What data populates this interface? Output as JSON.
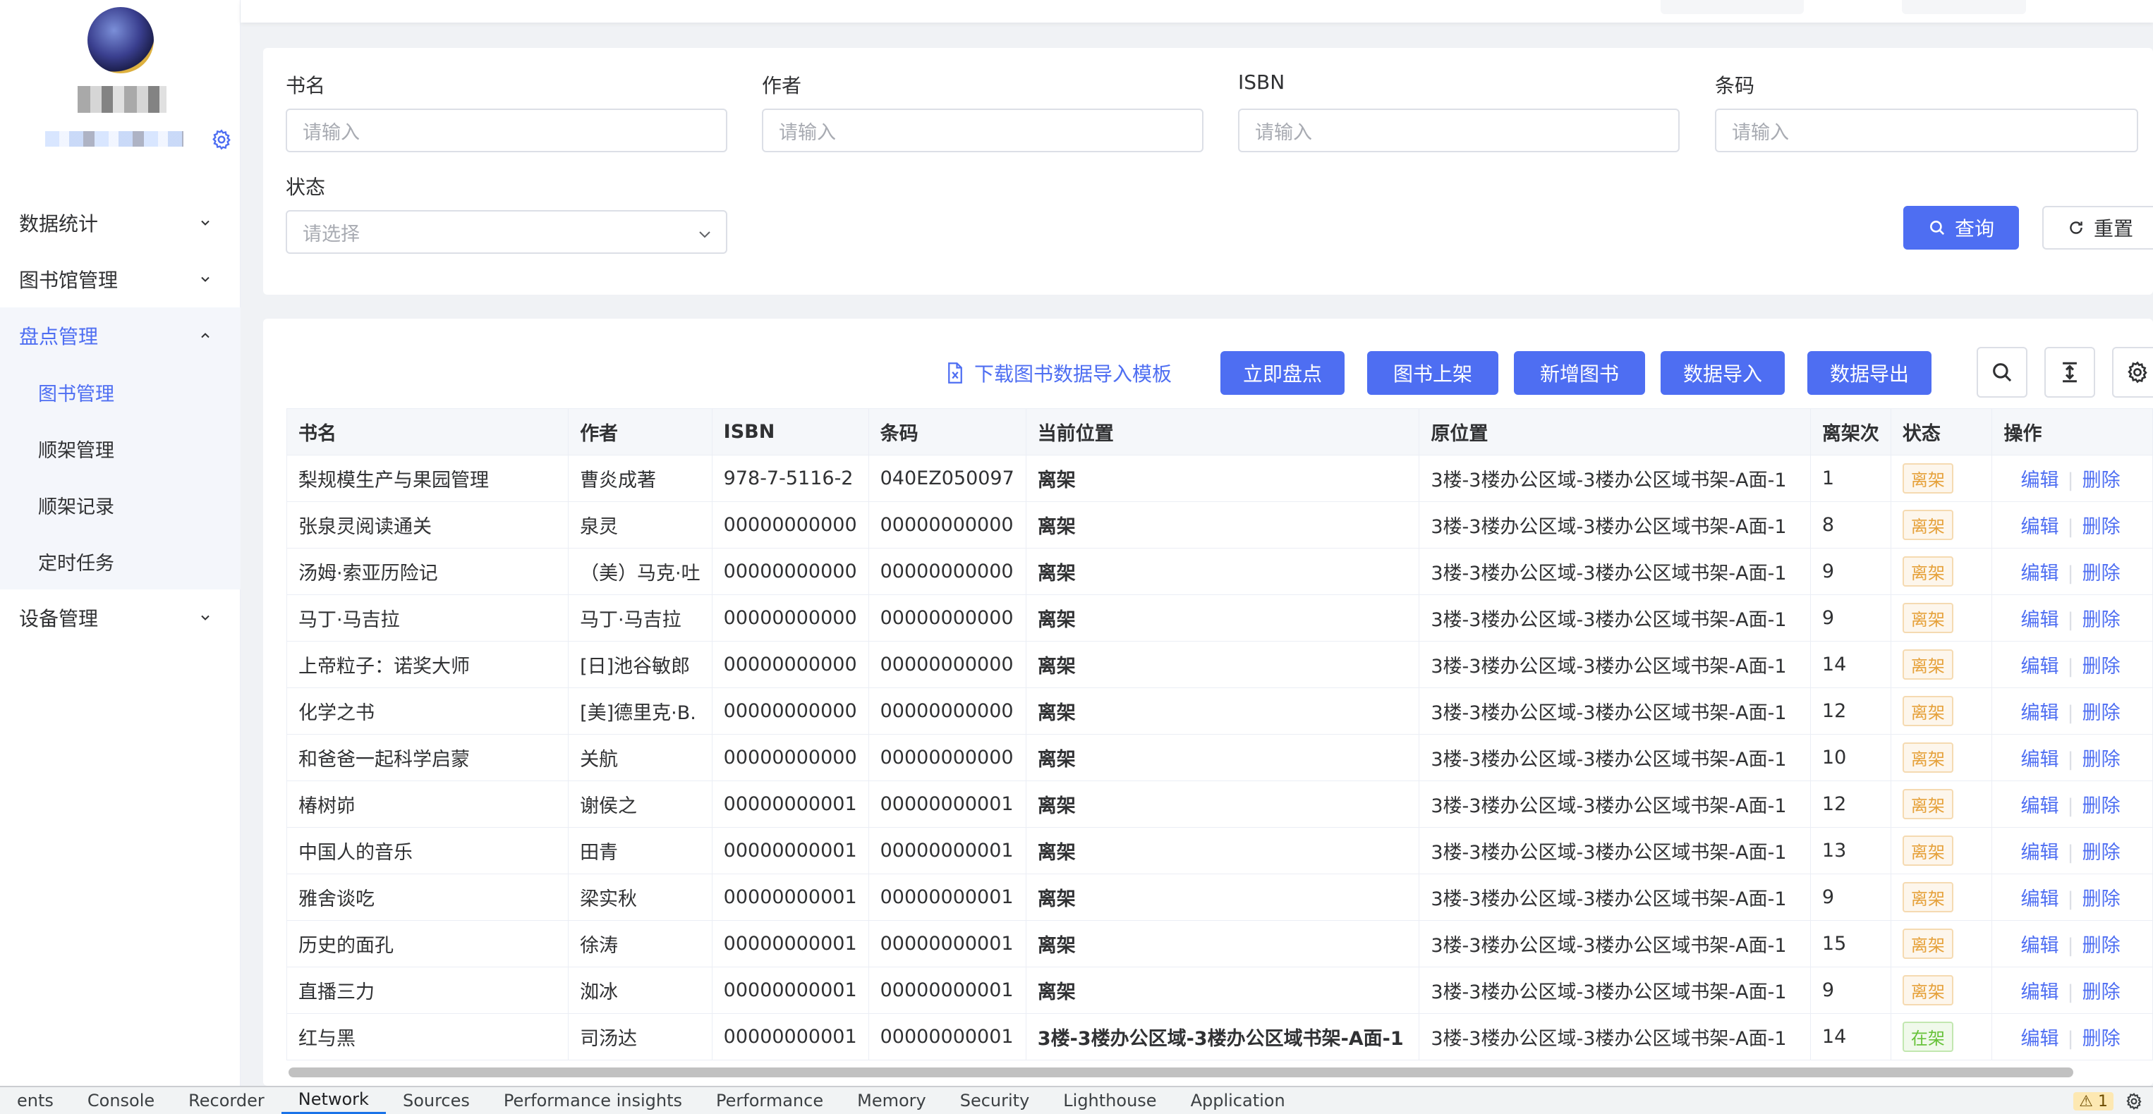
{
  "sidebar": {
    "menu": [
      {
        "label": "数据统计"
      },
      {
        "label": "图书馆管理"
      },
      {
        "label": "盘点管理",
        "sub": [
          {
            "label": "图书管理"
          },
          {
            "label": "顺架管理"
          },
          {
            "label": "顺架记录"
          },
          {
            "label": "定时任务"
          }
        ]
      },
      {
        "label": "设备管理"
      }
    ]
  },
  "search": {
    "fields": [
      {
        "label": "书名",
        "placeholder": "请输入"
      },
      {
        "label": "作者",
        "placeholder": "请输入"
      },
      {
        "label": "ISBN",
        "placeholder": "请输入"
      },
      {
        "label": "条码",
        "placeholder": "请输入"
      }
    ],
    "status": {
      "label": "状态",
      "placeholder": "请选择"
    },
    "query_label": "查询",
    "reset_label": "重置"
  },
  "toolbar": {
    "download_label": "下载图书数据导入模板",
    "buttons": [
      "立即盘点",
      "图书上架",
      "新增图书",
      "数据导入",
      "数据导出"
    ]
  },
  "table": {
    "columns": [
      "书名",
      "作者",
      "ISBN",
      "条码",
      "当前位置",
      "原位置",
      "离架次",
      "状态",
      "操作"
    ],
    "edit_label": "编辑",
    "delete_label": "删除",
    "rows": [
      {
        "title": "梨规模生产与果园管理",
        "author": "曹炎成著",
        "isbn": "978-7-5116-2",
        "barcode": "040EZ050097",
        "current": "离架",
        "origin": "3楼-3楼办公区域-3楼办公区域书架-A面-1",
        "count": "1",
        "status": "离架",
        "in_stock": false
      },
      {
        "title": "张泉灵阅读通关",
        "author": "泉灵",
        "isbn": "00000000000",
        "barcode": "00000000000",
        "current": "离架",
        "origin": "3楼-3楼办公区域-3楼办公区域书架-A面-1",
        "count": "8",
        "status": "离架",
        "in_stock": false
      },
      {
        "title": "汤姆·索亚历险记",
        "author": "（美）马克·吐",
        "isbn": "00000000000",
        "barcode": "00000000000",
        "current": "离架",
        "origin": "3楼-3楼办公区域-3楼办公区域书架-A面-1",
        "count": "9",
        "status": "离架",
        "in_stock": false
      },
      {
        "title": "马丁·马吉拉",
        "author": "马丁·马吉拉",
        "isbn": "00000000000",
        "barcode": "00000000000",
        "current": "离架",
        "origin": "3楼-3楼办公区域-3楼办公区域书架-A面-1",
        "count": "9",
        "status": "离架",
        "in_stock": false
      },
      {
        "title": "上帝粒子：诺奖大师",
        "author": "[日]池谷敏郎",
        "isbn": "00000000000",
        "barcode": "00000000000",
        "current": "离架",
        "origin": "3楼-3楼办公区域-3楼办公区域书架-A面-1",
        "count": "14",
        "status": "离架",
        "in_stock": false
      },
      {
        "title": "化学之书",
        "author": "[美]德里克·B.",
        "isbn": "00000000000",
        "barcode": "00000000000",
        "current": "离架",
        "origin": "3楼-3楼办公区域-3楼办公区域书架-A面-1",
        "count": "12",
        "status": "离架",
        "in_stock": false
      },
      {
        "title": "和爸爸一起科学启蒙",
        "author": "关航",
        "isbn": "00000000000",
        "barcode": "00000000000",
        "current": "离架",
        "origin": "3楼-3楼办公区域-3楼办公区域书架-A面-1",
        "count": "10",
        "status": "离架",
        "in_stock": false
      },
      {
        "title": "椿树峁",
        "author": "谢侯之",
        "isbn": "00000000001",
        "barcode": "00000000001",
        "current": "离架",
        "origin": "3楼-3楼办公区域-3楼办公区域书架-A面-1",
        "count": "12",
        "status": "离架",
        "in_stock": false
      },
      {
        "title": "中国人的音乐",
        "author": "田青",
        "isbn": "00000000001",
        "barcode": "00000000001",
        "current": "离架",
        "origin": "3楼-3楼办公区域-3楼办公区域书架-A面-1",
        "count": "13",
        "status": "离架",
        "in_stock": false
      },
      {
        "title": "雅舍谈吃",
        "author": "梁实秋",
        "isbn": "00000000001",
        "barcode": "00000000001",
        "current": "离架",
        "origin": "3楼-3楼办公区域-3楼办公区域书架-A面-1",
        "count": "9",
        "status": "离架",
        "in_stock": false
      },
      {
        "title": "历史的面孔",
        "author": "徐涛",
        "isbn": "00000000001",
        "barcode": "00000000001",
        "current": "离架",
        "origin": "3楼-3楼办公区域-3楼办公区域书架-A面-1",
        "count": "15",
        "status": "离架",
        "in_stock": false
      },
      {
        "title": "直播三力",
        "author": "洳冰",
        "isbn": "00000000001",
        "barcode": "00000000001",
        "current": "离架",
        "origin": "3楼-3楼办公区域-3楼办公区域书架-A面-1",
        "count": "9",
        "status": "离架",
        "in_stock": false
      },
      {
        "title": "红与黑",
        "author": "司汤达",
        "isbn": "00000000001",
        "barcode": "00000000001",
        "current": "3楼-3楼办公区域-3楼办公区域书架-A面-1",
        "count": "14",
        "origin": "3楼-3楼办公区域-3楼办公区域书架-A面-1",
        "status": "在架",
        "in_stock": true
      }
    ]
  },
  "devtools": {
    "tabs": [
      "ents",
      "Console",
      "Recorder",
      "Network",
      "Sources",
      "Performance insights",
      "Performance",
      "Memory",
      "Security",
      "Lighthouse",
      "Application"
    ],
    "active_tab": "Network",
    "issues_count": "1"
  },
  "colors": {
    "accent": "#4e6ef2",
    "warning": "#e6a23c",
    "success": "#67c23a"
  }
}
